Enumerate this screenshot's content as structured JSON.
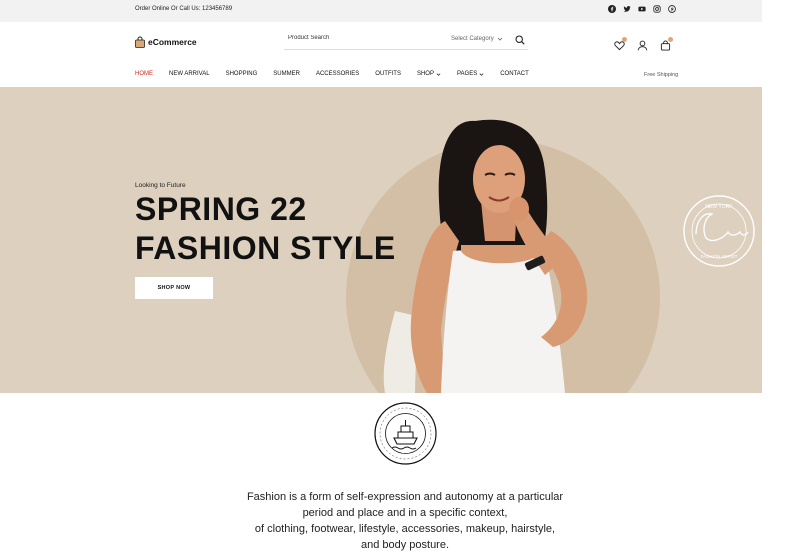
{
  "topbar": {
    "phone": "Order Online Or Call Us: 123456789",
    "social_icons": [
      "facebook-icon",
      "twitter-icon",
      "youtube-icon",
      "instagram-icon",
      "pinterest-icon"
    ]
  },
  "header": {
    "logo_text": "eCommerce",
    "search_placeholder": "Product Search",
    "category_label": "Select Category",
    "icons": [
      "heart-icon",
      "user-icon",
      "cart-icon"
    ]
  },
  "nav": {
    "items": [
      {
        "label": "HOME",
        "active": true
      },
      {
        "label": "NEW ARRIVAL"
      },
      {
        "label": "SHOPPING"
      },
      {
        "label": "SUMMER"
      },
      {
        "label": "ACCESSORIES"
      },
      {
        "label": "OUTFITS"
      },
      {
        "label": "SHOP",
        "dropdown": true
      },
      {
        "label": "PAGES",
        "dropdown": true
      },
      {
        "label": "CONTACT"
      }
    ],
    "right_text": "Free Shipping"
  },
  "hero": {
    "subtitle": "Looking to Future",
    "title_line1": "SPRING 22",
    "title_line2": "FASHION STYLE",
    "button_label": "SHOP NOW",
    "badge": {
      "top": "NEW YORK",
      "script": "Clothes",
      "bottom": "FASHION ARTIST"
    }
  },
  "store_logo": {
    "ring_text": "WOODROOM FURNITURE STORE"
  },
  "description": {
    "line1": "Fashion is a form of self-expression and autonomy at a particular",
    "line2": "period and place and in a specific context,",
    "line3": "of clothing, footwear, lifestyle, accessories, makeup, hairstyle,",
    "line4": "and body posture."
  },
  "colors": {
    "accent": "#d12a1e",
    "hero_bg": "#ddd0bf",
    "hero_circle": "#d2bfa6",
    "topbar_bg": "#f2f2f2"
  }
}
